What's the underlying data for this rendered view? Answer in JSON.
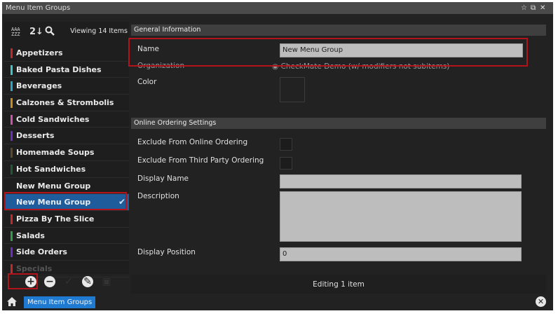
{
  "window": {
    "title": "Menu Item Groups",
    "controls": [
      "☆",
      "⧉",
      "✕"
    ]
  },
  "sidebar": {
    "viewing": "Viewing 14 Items",
    "sort_az_label": "AAA ZZZ",
    "items": [
      {
        "label": "Appetizers",
        "color": "#c62828"
      },
      {
        "label": "Baked Pasta Dishes",
        "color": "#3bc5c5"
      },
      {
        "label": "Beverages",
        "color": "#2aa6c9"
      },
      {
        "label": "Calzones & Strombolis",
        "color": "#c98c1c"
      },
      {
        "label": "Cold Sandwiches",
        "color": "#d04fa8"
      },
      {
        "label": "Desserts",
        "color": "#6a2fbf"
      },
      {
        "label": "Homemade Soups",
        "color": "#5a4a2a"
      },
      {
        "label": "Hot Sandwiches",
        "color": "#1f5a35"
      },
      {
        "label": "New Menu Group",
        "color": ""
      },
      {
        "label": "New Menu Group",
        "color": "",
        "selected": true
      },
      {
        "label": "Pizza By The Slice",
        "color": "#c62828"
      },
      {
        "label": "Salads",
        "color": "#2e9e4a"
      },
      {
        "label": "Side Orders",
        "color": "#6a2fbf"
      },
      {
        "label": "Specials",
        "color": "#c62828"
      }
    ]
  },
  "general": {
    "header": "General Information",
    "name_label": "Name",
    "name_value": "New Menu Group",
    "org_label": "Organization",
    "org_value": "CheckMate Demo (w/ modifiers not subitems)",
    "color_label": "Color"
  },
  "online": {
    "header": "Online Ordering Settings",
    "exclude_online_label": "Exclude From Online Ordering",
    "exclude_third_label": "Exclude From Third Party Ordering",
    "display_name_label": "Display Name",
    "display_name_value": "",
    "description_label": "Description",
    "description_value": "",
    "display_position_label": "Display Position",
    "display_position_value": "0"
  },
  "footer": {
    "status": "Editing 1 item"
  },
  "statusbar": {
    "breadcrumb": "Menu Item Groups"
  }
}
